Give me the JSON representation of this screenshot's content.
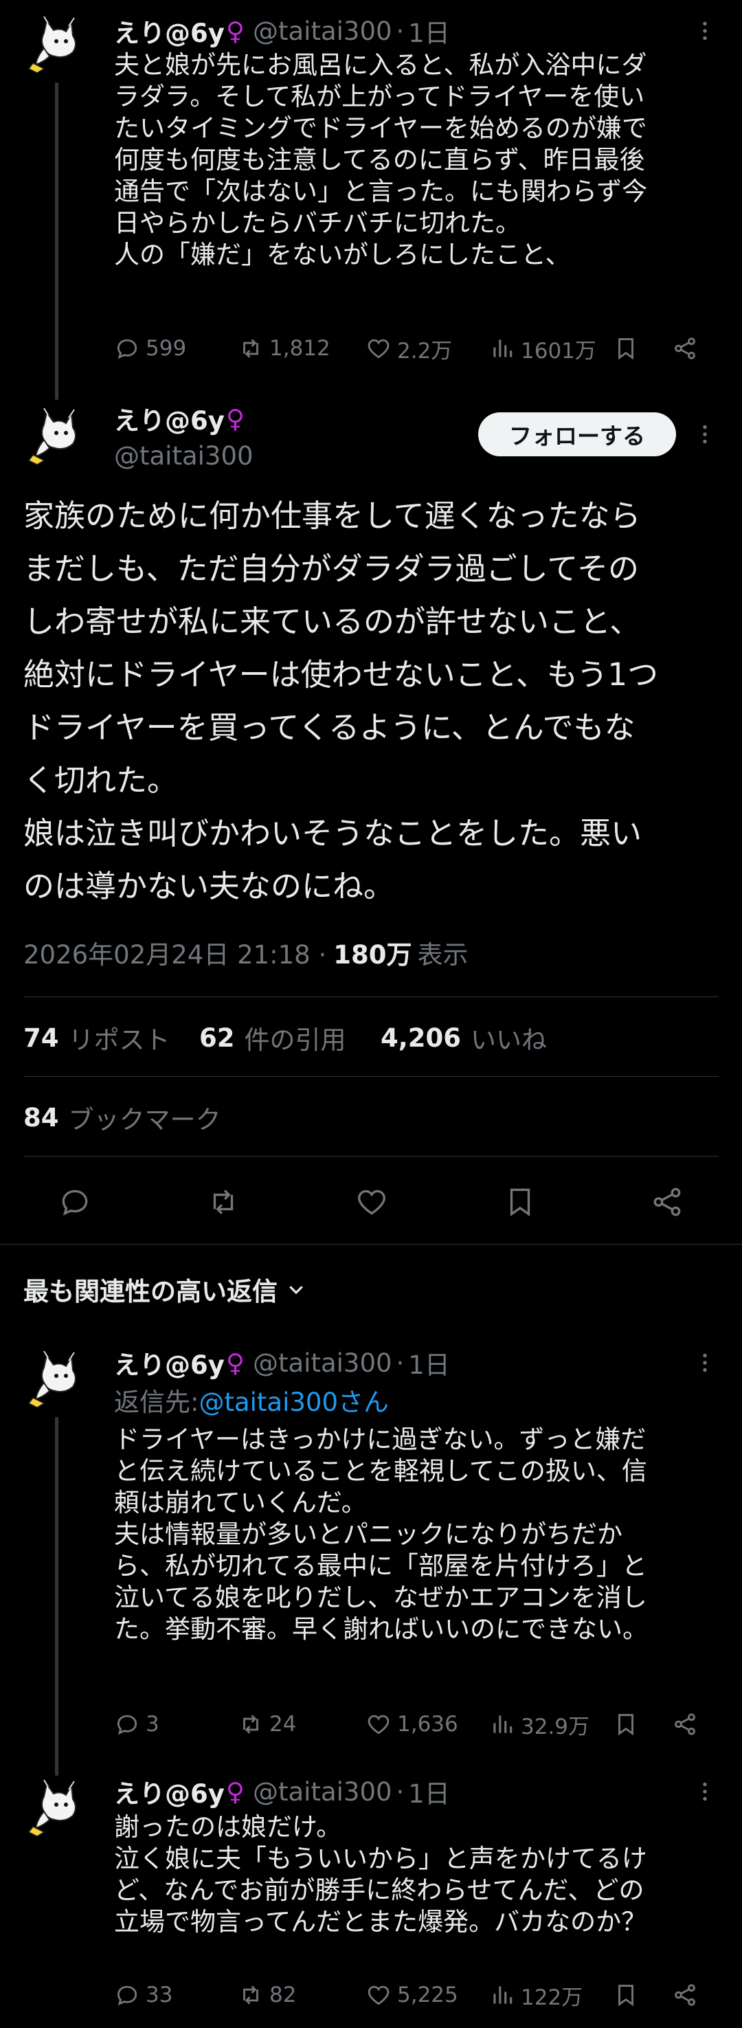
{
  "tweets": [
    {
      "name": "えり@6y",
      "gender_symbol": "♀",
      "handle": "@taitai300",
      "time": "1日",
      "text": "夫と娘が先にお風呂に入ると、私が入浴中にダ\nラダラ。そして私が上がってドライヤーを使い\nたいタイミングでドライヤーを始めるのが嫌で\n何度も何度も注意してるのに直らず、昨日最後\n通告で「次はない」と言った。にも関わらず今\n日やらかしたらバチバチに切れた。\n人の「嫌だ」をないがしろにしたこと、",
      "replies": "599",
      "reposts": "1,812",
      "likes": "2.2万",
      "views": "1601万"
    },
    {
      "name": "えり@6y",
      "gender_symbol": "♀",
      "handle": "@taitai300",
      "time": "1日",
      "reply_to_label": "返信先: ",
      "reply_to_handle": "@taitai300さん",
      "text": "ドライヤーはきっかけに過ぎない。ずっと嫌だ\nと伝え続けていることを軽視してこの扱い、信\n頼は崩れていくんだ。\n夫は情報量が多いとパニックになりがちだか\nら、私が切れてる最中に「部屋を片付けろ」と\n泣いてる娘を叱りだし、なぜかエアコンを消し\nた。挙動不審。早く謝ればいいのにできない。",
      "replies": "3",
      "reposts": "24",
      "likes": "1,636",
      "views": "32.9万"
    },
    {
      "name": "えり@6y",
      "gender_symbol": "♀",
      "handle": "@taitai300",
      "time": "1日",
      "text": "謝ったのは娘だけ。\n泣く娘に夫「もういいから」と声をかけてるけ\nど、なんでお前が勝手に終わらせてんだ、どの\n立場で物言ってんだとまた爆発。バカなのか？",
      "replies": "33",
      "reposts": "82",
      "likes": "5,225",
      "views": "122万"
    }
  ],
  "main": {
    "name": "えり@6y",
    "gender_symbol": "♀",
    "handle": "@taitai300",
    "follow_label": "フォローする",
    "text": "家族のために何か仕事をして遅くなったなら\nまだしも、ただ自分がダラダラ過ごしてその\nしわ寄せが私に来ているのが許せないこと、\n絶対にドライヤーは使わせないこと、もう1つ\nドライヤーを買ってくるように、とんでもな\nく切れた。\n娘は泣き叫びかわいそうなことをした。悪い\nのは導かない夫なのにね。",
    "datetime": "2026年02月24日 21:18 · ",
    "views": "180万",
    "views_label": "表示",
    "reposts": "74",
    "reposts_label": "リポスト",
    "quotes": "62",
    "quotes_label": "件の引用",
    "likes": "4,206",
    "likes_label": "いいね",
    "bookmarks": "84",
    "bookmarks_label": "ブックマーク"
  },
  "sort_label": "最も関連性の高い返信",
  "colors": {
    "background": "#000000",
    "text": "#e7e9ea",
    "muted": "#71767b",
    "link": "#1d9bf0",
    "female_symbol": "#c02bd9",
    "follow_bg": "#eff3f4"
  }
}
